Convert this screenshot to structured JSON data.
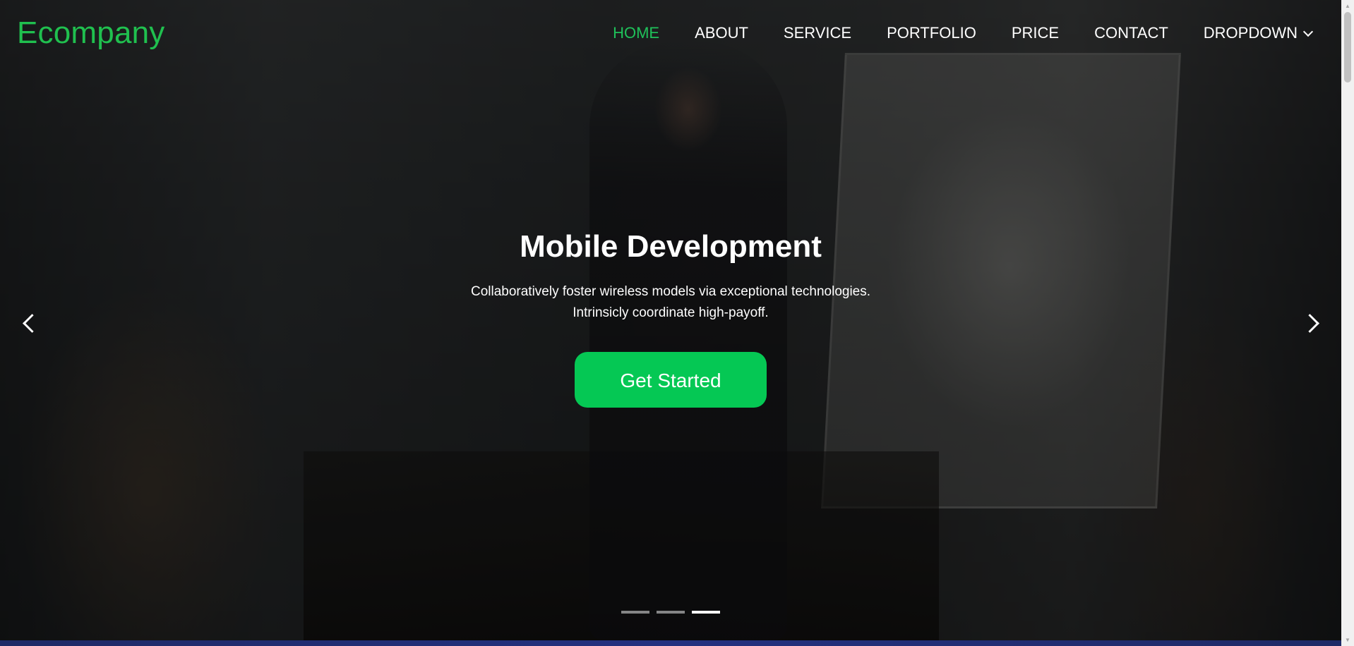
{
  "header": {
    "logo": "Ecompany",
    "nav": [
      {
        "label": "HOME",
        "active": true
      },
      {
        "label": "ABOUT"
      },
      {
        "label": "SERVICE"
      },
      {
        "label": "PORTFOLIO"
      },
      {
        "label": "PRICE"
      },
      {
        "label": "CONTACT"
      },
      {
        "label": "DROPDOWN",
        "icon": "chevron-down-icon"
      }
    ]
  },
  "hero": {
    "title": "Mobile Development",
    "desc_line1": "Collaboratively foster wireless models via exceptional technologies.",
    "desc_line2": "Intrinsicly coordinate high-payoff.",
    "cta_label": "Get Started",
    "prev_icon": "chevron-left-icon",
    "next_icon": "chevron-right-icon",
    "slides_total": 3,
    "active_slide": 3
  },
  "colors": {
    "brand": "#20c04f",
    "nav_active": "#1fc15a",
    "cta": "#05c854"
  }
}
